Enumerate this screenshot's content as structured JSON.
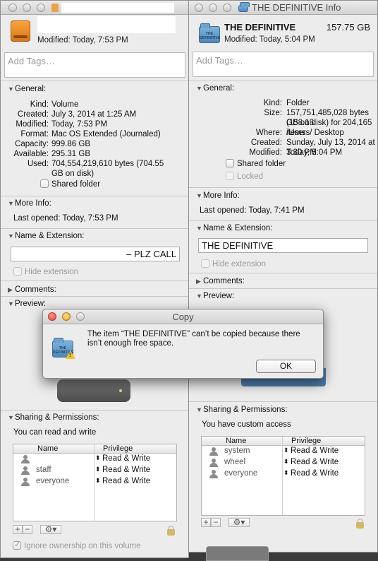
{
  "left": {
    "title": "",
    "modified_header": "Modified: Today, 7:53 PM",
    "tags_placeholder": "Add Tags…",
    "general_header": "General:",
    "general": [
      {
        "k": "Kind:",
        "v": "Volume"
      },
      {
        "k": "Created:",
        "v": "July 3, 2014 at 1:25 AM"
      },
      {
        "k": "Modified:",
        "v": "Today, 7:53 PM"
      },
      {
        "k": "Format:",
        "v": "Mac OS Extended (Journaled)"
      },
      {
        "k": "Capacity:",
        "v": "999.86 GB"
      },
      {
        "k": "Available:",
        "v": "295.31 GB"
      },
      {
        "k": "Used:",
        "v": "704,554,219,610 bytes (704.55"
      },
      {
        "k": "",
        "v": "GB on disk)"
      }
    ],
    "shared_folder": "Shared folder",
    "more_info_header": "More Info:",
    "last_opened": "Last opened: Today, 7:53 PM",
    "name_ext_header": "Name & Extension:",
    "name_value": "– PLZ CALL",
    "hide_extension": "Hide extension",
    "comments_header": "Comments:",
    "preview_header": "Preview:",
    "sharing_header": "Sharing & Permissions:",
    "access_text": "You can read and write",
    "col_name": "Name",
    "col_priv": "Privilege",
    "perms": [
      {
        "name": "",
        "priv": "Read & Write"
      },
      {
        "name": "staff",
        "priv": "Read & Write"
      },
      {
        "name": "everyone",
        "priv": "Read & Write"
      }
    ],
    "ignore_ownership": "Ignore ownership on this volume"
  },
  "right": {
    "title": "THE DEFINITIVE Info",
    "name": "THE DEFINITIVE",
    "size_header": "157.75 GB",
    "modified_header": "Modified: Today, 5:04 PM",
    "folder_icon_text": "THE DEFINITIVE",
    "tags_placeholder": "Add Tags…",
    "general_header": "General:",
    "general": [
      {
        "k": "Kind:",
        "v": "Folder"
      },
      {
        "k": "Size:",
        "v": "157,751,485,028 bytes (158.18"
      },
      {
        "k": "",
        "v": "GB on disk) for 204,165 items"
      },
      {
        "k": "Where:",
        "v": "/Users/         Desktop"
      },
      {
        "k": "Created:",
        "v": "Sunday, July 13, 2014 at 3:30 PM"
      },
      {
        "k": "Modified:",
        "v": "Today, 5:04 PM"
      }
    ],
    "shared_folder": "Shared folder",
    "locked": "Locked",
    "more_info_header": "More Info:",
    "last_opened": "Last opened: Today, 7:41 PM",
    "name_ext_header": "Name & Extension:",
    "name_value": "THE DEFINITIVE",
    "hide_extension": "Hide extension",
    "comments_header": "Comments:",
    "preview_header": "Preview:",
    "sharing_header": "Sharing & Permissions:",
    "access_text": "You have custom access",
    "col_name": "Name",
    "col_priv": "Privilege",
    "perms": [
      {
        "name": "system",
        "priv": "Read & Write"
      },
      {
        "name": "wheel",
        "priv": "Read & Write"
      },
      {
        "name": "everyone",
        "priv": "Read & Write"
      }
    ]
  },
  "dialog": {
    "title": "Copy",
    "message": "The item “THE DEFINITIVE” can’t be copied because there isn’t enough free space.",
    "ok": "OK"
  },
  "colors": {
    "window_bg": "#ececec",
    "folder_blue": "#5b93c4",
    "warning_yellow": "#f4c22b"
  }
}
